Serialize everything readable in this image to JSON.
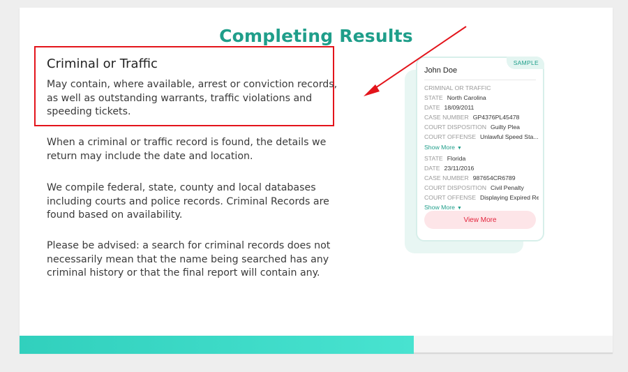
{
  "page": {
    "title": "Completing Results"
  },
  "section": {
    "heading": "Criminal or Traffic",
    "paragraphs": [
      "May contain, where available, arrest or conviction records, as well as outstanding warrants, traffic violations and speeding tickets.",
      "When a criminal or traffic record is found, the details we return may include the date and location.",
      "We compile federal, state, county and local databases including courts and police records. Criminal Records are found based on availability.",
      "Please be advised: a search for criminal records does not necessarily mean that the name being searched has any criminal history or that the final report will contain any."
    ]
  },
  "annotation": {
    "highlight_color": "#e3141b",
    "arrow_color": "#e3141b"
  },
  "sample_card": {
    "badge": "SAMPLE",
    "name": "John Doe",
    "section_title": "CRIMINAL OR TRAFFIC",
    "records": [
      {
        "fields": [
          {
            "label": "STATE",
            "value": "North Carolina"
          },
          {
            "label": "DATE",
            "value": "18/09/2011"
          },
          {
            "label": "CASE NUMBER",
            "value": "GP4376PL45478"
          },
          {
            "label": "COURT DISPOSITION",
            "value": "Guilty Plea"
          },
          {
            "label": "COURT OFFENSE",
            "value": "Unlawful Speed Sta..."
          }
        ],
        "show_more": "Show More"
      },
      {
        "fields": [
          {
            "label": "STATE",
            "value": "Florida"
          },
          {
            "label": "DATE",
            "value": "23/11/2016"
          },
          {
            "label": "CASE NUMBER",
            "value": "987654CR6789"
          },
          {
            "label": "COURT DISPOSITION",
            "value": "Civil Penalty"
          },
          {
            "label": "COURT OFFENSE",
            "value": "Displaying Expired Re..."
          }
        ],
        "show_more": "Show More"
      }
    ],
    "view_more": "View More"
  },
  "progress": {
    "fraction": 0.665,
    "color_start": "#31d0bd",
    "color_end": "#48e3d0"
  },
  "icons": {
    "caret": "▼"
  }
}
